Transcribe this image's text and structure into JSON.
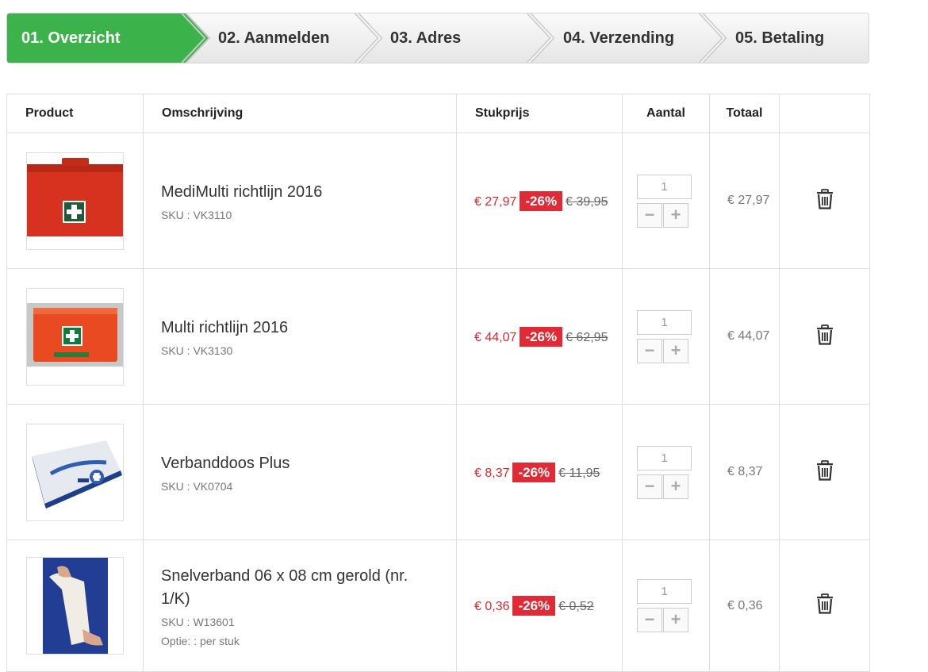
{
  "steps": [
    {
      "label": "01. Overzicht",
      "active": true
    },
    {
      "label": "02. Aanmelden",
      "active": false
    },
    {
      "label": "03. Adres",
      "active": false
    },
    {
      "label": "04. Verzending",
      "active": false
    },
    {
      "label": "05. Betaling",
      "active": false
    }
  ],
  "colors": {
    "active_step": "#3cb34a",
    "discount_badge": "#e02a36",
    "sale_price": "#d9262e"
  },
  "table": {
    "headers": {
      "product": "Product",
      "description": "Omschrijving",
      "unit_price": "Stukprijs",
      "quantity": "Aantal",
      "total": "Totaal"
    },
    "rows": [
      {
        "name": "MediMulti richtlijn 2016",
        "sku": "SKU : VK3110",
        "option": "",
        "price": "€ 27,97",
        "discount": "-26%",
        "old_price": "€ 39,95",
        "qty": "1",
        "total": "€ 27,97",
        "image": "red-first-aid-case"
      },
      {
        "name": "Multi richtlijn 2016",
        "sku": "SKU : VK3130",
        "option": "",
        "price": "€ 44,07",
        "discount": "-26%",
        "old_price": "€ 62,95",
        "qty": "1",
        "total": "€ 44,07",
        "image": "orange-first-aid-case"
      },
      {
        "name": "Verbanddoos Plus",
        "sku": "SKU : VK0704",
        "option": "",
        "price": "€ 8,37",
        "discount": "-26%",
        "old_price": "€ 11,95",
        "qty": "1",
        "total": "€ 8,37",
        "image": "blue-bandage-box"
      },
      {
        "name": "Snelverband 06 x 08 cm gerold (nr. 1/K)",
        "sku": "SKU : W13601",
        "option": "Optie: : per stuk",
        "price": "€ 0,36",
        "discount": "-26%",
        "old_price": "€ 0,52",
        "qty": "1",
        "total": "€ 0,36",
        "image": "bandage-roll"
      }
    ]
  },
  "qty_controls": {
    "minus": "−",
    "plus": "+"
  },
  "icons": {
    "delete": "trash-icon"
  }
}
